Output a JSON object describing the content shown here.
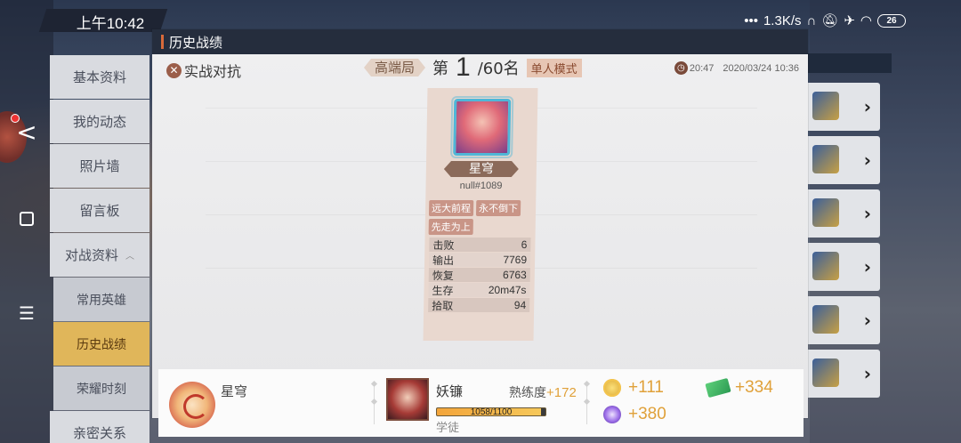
{
  "status_bar": {
    "time": "上午10:42",
    "network_speed": "1.3K/s",
    "battery": "26",
    "icons": [
      "more-dots-icon",
      "headset-icon",
      "mute-bell-icon",
      "airplane-icon",
      "wifi-icon"
    ]
  },
  "system_nav": {
    "back": "<",
    "menu": "☰"
  },
  "sidebar": {
    "items": [
      {
        "label": "基本资料"
      },
      {
        "label": "我的动态"
      },
      {
        "label": "照片墙"
      },
      {
        "label": "留言板"
      },
      {
        "label": "对战资料"
      }
    ],
    "sub_items": [
      {
        "label": "常用英雄"
      },
      {
        "label": "历史战绩",
        "active": true
      },
      {
        "label": "荣耀时刻"
      }
    ],
    "last_item": {
      "label": "亲密关系"
    }
  },
  "modal": {
    "title": "历史战绩",
    "mode_label": "实战对抗",
    "rank_tier": "高端局",
    "rank_prefix": "第",
    "rank_number": "1",
    "rank_total": "/60名",
    "match_mode": "单人模式",
    "duration": "20:47",
    "datetime": "2020/03/24 10:36"
  },
  "player_card": {
    "name": "星穹",
    "id": "null#1089",
    "tags": [
      "远大前程",
      "永不倒下",
      "先走为上"
    ],
    "stats": [
      {
        "label": "击败",
        "value": "6"
      },
      {
        "label": "输出",
        "value": "7769"
      },
      {
        "label": "恢复",
        "value": "6763"
      },
      {
        "label": "生存",
        "value": "20m47s"
      },
      {
        "label": "拾取",
        "value": "94"
      }
    ]
  },
  "footer": {
    "player_name": "星穹",
    "hero_name": "妖镰",
    "mastery_label": "熟练度",
    "mastery_gain": "+172",
    "xp_text": "1058/1100",
    "xp_progress": 0.96,
    "hero_rank": "学徒",
    "gold_gain": "+111",
    "exp_gain": "+380",
    "ticket_gain": "+334"
  },
  "colors": {
    "accent_gold": "#e0a13a",
    "title_bar": "#252d3d",
    "active_tab": "#e0b65a"
  }
}
